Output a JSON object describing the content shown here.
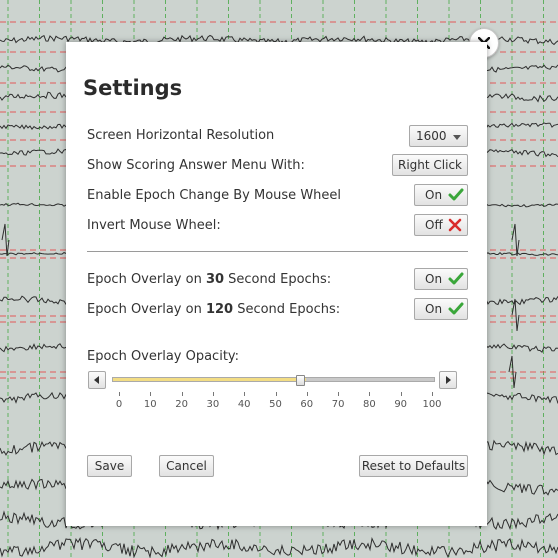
{
  "dialog": {
    "title": "Settings",
    "close_icon": "close-icon",
    "rows": {
      "resolution": {
        "label": "Screen Horizontal Resolution",
        "value": "1600"
      },
      "answer_menu": {
        "label": "Show Scoring Answer Menu With:",
        "value": "Right Click"
      },
      "epoch_wheel": {
        "label": "Enable Epoch Change By Mouse Wheel",
        "state": "On",
        "icon": "check-icon"
      },
      "invert_wheel": {
        "label": "Invert Mouse Wheel:",
        "state": "Off",
        "icon": "x-icon"
      },
      "overlay30": {
        "pre": "Epoch Overlay on ",
        "num": "30",
        "post": " Second Epochs:",
        "state": "On",
        "icon": "check-icon"
      },
      "overlay120": {
        "pre": "Epoch Overlay on ",
        "num": "120",
        "post": " Second Epochs:",
        "state": "On",
        "icon": "check-icon"
      }
    },
    "opacity": {
      "label": "Epoch Overlay Opacity:",
      "value": 60,
      "min": 0,
      "max": 100,
      "ticks": [
        "0",
        "10",
        "20",
        "30",
        "40",
        "50",
        "60",
        "70",
        "80",
        "90",
        "100"
      ]
    },
    "buttons": {
      "save": "Save",
      "cancel": "Cancel",
      "reset": "Reset to Defaults"
    }
  },
  "colors": {
    "background": "#ccd3cf",
    "grid_dashed_green": "#5fb05f",
    "grid_dashed_red": "#e25a5a",
    "slider_fill": "#f3dd84",
    "check": "#3aa63a",
    "cross": "#d92b2b"
  }
}
